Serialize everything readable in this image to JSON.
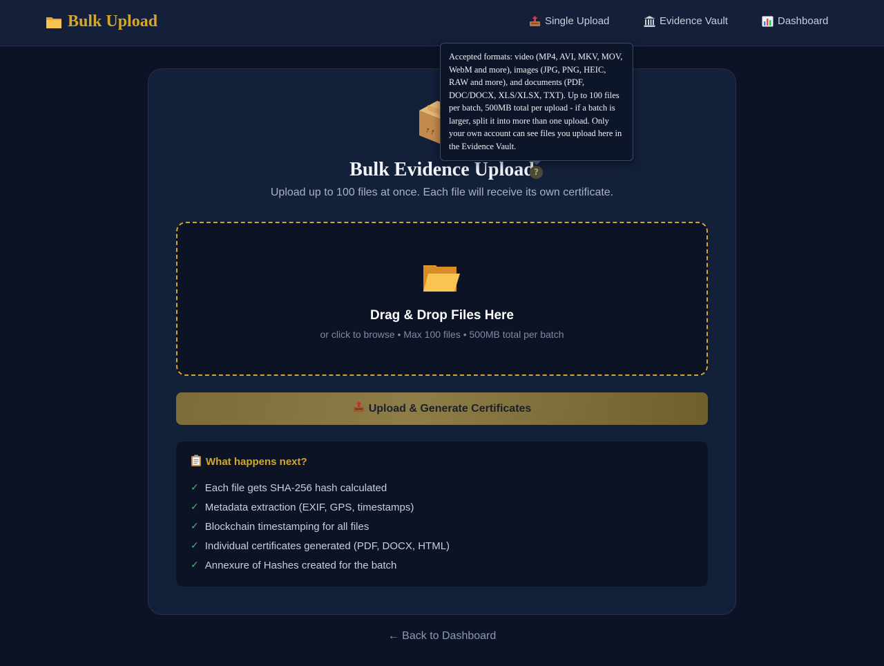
{
  "header": {
    "brand": "Bulk Upload",
    "nav": [
      {
        "label": "Single Upload",
        "icon": "outbox-tray-icon"
      },
      {
        "label": "Evidence Vault",
        "icon": "classical-building-icon"
      },
      {
        "label": "Dashboard",
        "icon": "bar-chart-icon"
      }
    ]
  },
  "main": {
    "title": "Bulk Evidence Upload",
    "help_symbol": "?",
    "subtitle": "Upload up to 100 files at once. Each file will receive its own certificate.",
    "tooltip": "Accepted formats: video (MP4, AVI, MKV, MOV, WebM and more), images (JPG, PNG, HEIC, RAW and more), and documents (PDF, DOC/DOCX, XLS/XLSX, TXT). Up to 100 files per batch, 500MB total per upload - if a batch is larger, split it into more than one upload. Only your own account can see files you upload here in the Evidence Vault.",
    "dropzone": {
      "title": "Drag & Drop Files Here",
      "subtitle": "or click to browse • Max 100 files • 500MB total per batch"
    },
    "upload_button": "Upload & Generate Certificates",
    "info": {
      "title": "What happens next?",
      "items": [
        "Each file gets SHA-256 hash calculated",
        "Metadata extraction (EXIF, GPS, timestamps)",
        "Blockchain timestamping for all files",
        "Individual certificates generated (PDF, DOCX, HTML)",
        "Annexure of Hashes created for the batch"
      ]
    },
    "back_link": "← Back to Dashboard"
  },
  "colors": {
    "accent": "#d4a72c",
    "background": "#0b1324",
    "card": "#13203a",
    "check": "#4fb56f"
  }
}
